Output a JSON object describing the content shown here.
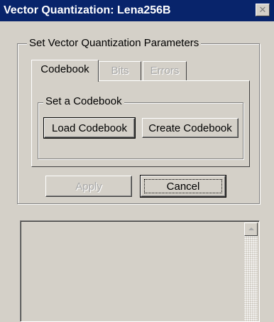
{
  "window": {
    "title": "Vector Quantization: Lena256B",
    "close_glyph": "✕"
  },
  "params_group": {
    "legend": "Set Vector Quantization Parameters"
  },
  "tabs": [
    {
      "label": "Codebook",
      "active": true,
      "enabled": true
    },
    {
      "label": "Bits",
      "active": false,
      "enabled": false
    },
    {
      "label": "Errors",
      "active": false,
      "enabled": false
    }
  ],
  "codebook_group": {
    "legend": "Set a Codebook",
    "load_label": "Load Codebook",
    "create_label": "Create Codebook"
  },
  "actions": {
    "apply_label": "Apply",
    "cancel_label": "Cancel"
  },
  "icons": {
    "close": "close-icon",
    "scroll_up": "scroll-up-arrow-icon"
  }
}
